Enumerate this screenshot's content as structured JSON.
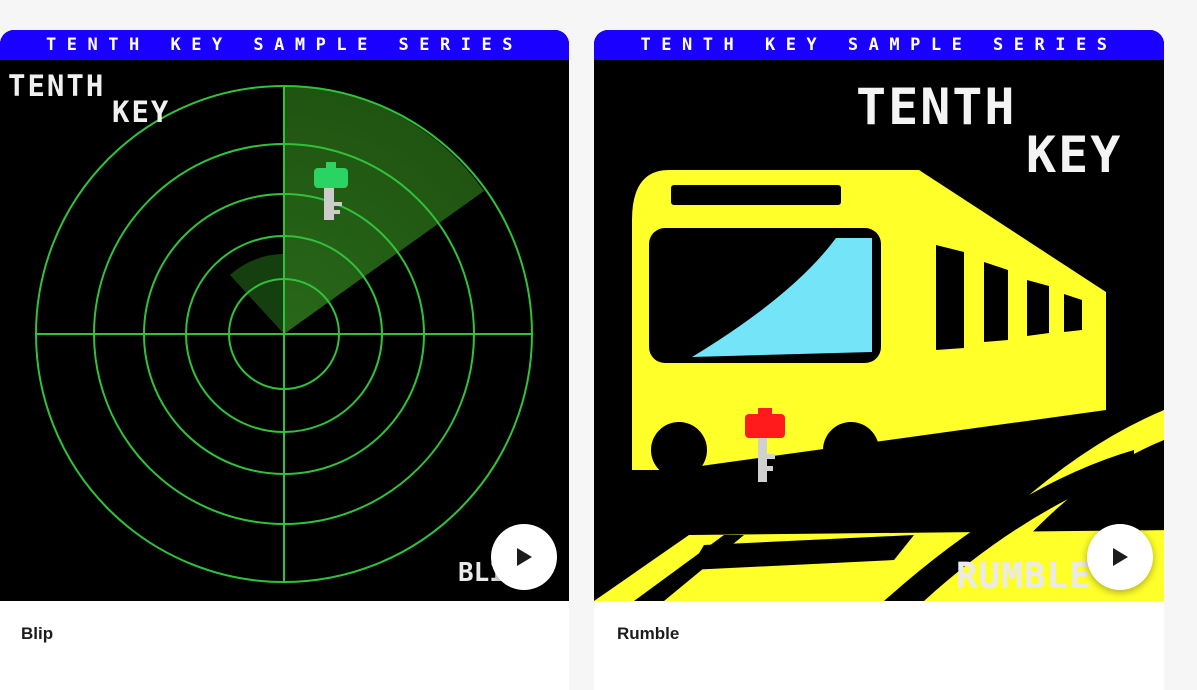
{
  "cards": [
    {
      "banner": "TENTH KEY SAMPLE SERIES",
      "brand_line1": "TENTH",
      "brand_line2": "KEY",
      "album_word": "BLIP",
      "title": "Blip",
      "play_icon": "play-icon"
    },
    {
      "banner": "TENTH KEY SAMPLE SERIES",
      "brand_line1": "TENTH",
      "brand_line2": "KEY",
      "album_word": "RUMBLE",
      "title": "Rumble",
      "play_icon": "play-icon"
    }
  ],
  "colors": {
    "banner": "#1a00ff",
    "radar_green": "#2fc23a",
    "train_yellow": "#ffff2a",
    "window_blue": "#74e4f8",
    "key_red": "#ff1b1b",
    "key_green": "#29d463"
  }
}
